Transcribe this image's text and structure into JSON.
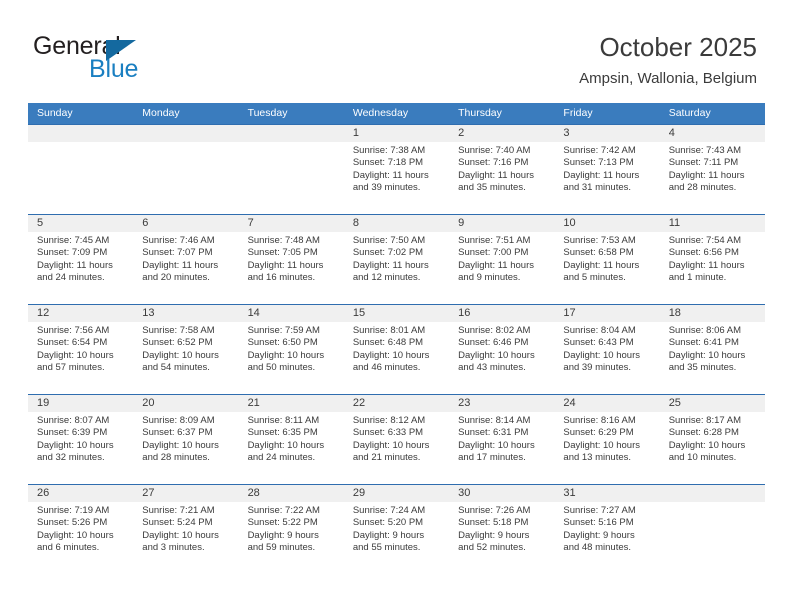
{
  "brand": {
    "word1": "General",
    "word2": "Blue",
    "logo_icon": "triangle-flag-icon",
    "color_primary": "#14699f",
    "color_text": "#231f20"
  },
  "header": {
    "title": "October 2025",
    "subtitle": "Ampsin, Wallonia, Belgium"
  },
  "theme": {
    "header_row_bg": "#3a7cbe",
    "week_divider": "#2f6daf",
    "daynum_band_bg": "#f0f0f0",
    "text": "#3b3b3b"
  },
  "weekday_headers": [
    "Sunday",
    "Monday",
    "Tuesday",
    "Wednesday",
    "Thursday",
    "Friday",
    "Saturday"
  ],
  "weeks": [
    [
      {
        "day": "",
        "empty": true,
        "sunrise": "",
        "sunset": "",
        "daylight_l1": "",
        "daylight_l2": ""
      },
      {
        "day": "",
        "empty": true,
        "sunrise": "",
        "sunset": "",
        "daylight_l1": "",
        "daylight_l2": ""
      },
      {
        "day": "",
        "empty": true,
        "sunrise": "",
        "sunset": "",
        "daylight_l1": "",
        "daylight_l2": ""
      },
      {
        "day": "1",
        "empty": false,
        "sunrise": "Sunrise: 7:38 AM",
        "sunset": "Sunset: 7:18 PM",
        "daylight_l1": "Daylight: 11 hours",
        "daylight_l2": "and 39 minutes."
      },
      {
        "day": "2",
        "empty": false,
        "sunrise": "Sunrise: 7:40 AM",
        "sunset": "Sunset: 7:16 PM",
        "daylight_l1": "Daylight: 11 hours",
        "daylight_l2": "and 35 minutes."
      },
      {
        "day": "3",
        "empty": false,
        "sunrise": "Sunrise: 7:42 AM",
        "sunset": "Sunset: 7:13 PM",
        "daylight_l1": "Daylight: 11 hours",
        "daylight_l2": "and 31 minutes."
      },
      {
        "day": "4",
        "empty": false,
        "sunrise": "Sunrise: 7:43 AM",
        "sunset": "Sunset: 7:11 PM",
        "daylight_l1": "Daylight: 11 hours",
        "daylight_l2": "and 28 minutes."
      }
    ],
    [
      {
        "day": "5",
        "empty": false,
        "sunrise": "Sunrise: 7:45 AM",
        "sunset": "Sunset: 7:09 PM",
        "daylight_l1": "Daylight: 11 hours",
        "daylight_l2": "and 24 minutes."
      },
      {
        "day": "6",
        "empty": false,
        "sunrise": "Sunrise: 7:46 AM",
        "sunset": "Sunset: 7:07 PM",
        "daylight_l1": "Daylight: 11 hours",
        "daylight_l2": "and 20 minutes."
      },
      {
        "day": "7",
        "empty": false,
        "sunrise": "Sunrise: 7:48 AM",
        "sunset": "Sunset: 7:05 PM",
        "daylight_l1": "Daylight: 11 hours",
        "daylight_l2": "and 16 minutes."
      },
      {
        "day": "8",
        "empty": false,
        "sunrise": "Sunrise: 7:50 AM",
        "sunset": "Sunset: 7:02 PM",
        "daylight_l1": "Daylight: 11 hours",
        "daylight_l2": "and 12 minutes."
      },
      {
        "day": "9",
        "empty": false,
        "sunrise": "Sunrise: 7:51 AM",
        "sunset": "Sunset: 7:00 PM",
        "daylight_l1": "Daylight: 11 hours",
        "daylight_l2": "and 9 minutes."
      },
      {
        "day": "10",
        "empty": false,
        "sunrise": "Sunrise: 7:53 AM",
        "sunset": "Sunset: 6:58 PM",
        "daylight_l1": "Daylight: 11 hours",
        "daylight_l2": "and 5 minutes."
      },
      {
        "day": "11",
        "empty": false,
        "sunrise": "Sunrise: 7:54 AM",
        "sunset": "Sunset: 6:56 PM",
        "daylight_l1": "Daylight: 11 hours",
        "daylight_l2": "and 1 minute."
      }
    ],
    [
      {
        "day": "12",
        "empty": false,
        "sunrise": "Sunrise: 7:56 AM",
        "sunset": "Sunset: 6:54 PM",
        "daylight_l1": "Daylight: 10 hours",
        "daylight_l2": "and 57 minutes."
      },
      {
        "day": "13",
        "empty": false,
        "sunrise": "Sunrise: 7:58 AM",
        "sunset": "Sunset: 6:52 PM",
        "daylight_l1": "Daylight: 10 hours",
        "daylight_l2": "and 54 minutes."
      },
      {
        "day": "14",
        "empty": false,
        "sunrise": "Sunrise: 7:59 AM",
        "sunset": "Sunset: 6:50 PM",
        "daylight_l1": "Daylight: 10 hours",
        "daylight_l2": "and 50 minutes."
      },
      {
        "day": "15",
        "empty": false,
        "sunrise": "Sunrise: 8:01 AM",
        "sunset": "Sunset: 6:48 PM",
        "daylight_l1": "Daylight: 10 hours",
        "daylight_l2": "and 46 minutes."
      },
      {
        "day": "16",
        "empty": false,
        "sunrise": "Sunrise: 8:02 AM",
        "sunset": "Sunset: 6:46 PM",
        "daylight_l1": "Daylight: 10 hours",
        "daylight_l2": "and 43 minutes."
      },
      {
        "day": "17",
        "empty": false,
        "sunrise": "Sunrise: 8:04 AM",
        "sunset": "Sunset: 6:43 PM",
        "daylight_l1": "Daylight: 10 hours",
        "daylight_l2": "and 39 minutes."
      },
      {
        "day": "18",
        "empty": false,
        "sunrise": "Sunrise: 8:06 AM",
        "sunset": "Sunset: 6:41 PM",
        "daylight_l1": "Daylight: 10 hours",
        "daylight_l2": "and 35 minutes."
      }
    ],
    [
      {
        "day": "19",
        "empty": false,
        "sunrise": "Sunrise: 8:07 AM",
        "sunset": "Sunset: 6:39 PM",
        "daylight_l1": "Daylight: 10 hours",
        "daylight_l2": "and 32 minutes."
      },
      {
        "day": "20",
        "empty": false,
        "sunrise": "Sunrise: 8:09 AM",
        "sunset": "Sunset: 6:37 PM",
        "daylight_l1": "Daylight: 10 hours",
        "daylight_l2": "and 28 minutes."
      },
      {
        "day": "21",
        "empty": false,
        "sunrise": "Sunrise: 8:11 AM",
        "sunset": "Sunset: 6:35 PM",
        "daylight_l1": "Daylight: 10 hours",
        "daylight_l2": "and 24 minutes."
      },
      {
        "day": "22",
        "empty": false,
        "sunrise": "Sunrise: 8:12 AM",
        "sunset": "Sunset: 6:33 PM",
        "daylight_l1": "Daylight: 10 hours",
        "daylight_l2": "and 21 minutes."
      },
      {
        "day": "23",
        "empty": false,
        "sunrise": "Sunrise: 8:14 AM",
        "sunset": "Sunset: 6:31 PM",
        "daylight_l1": "Daylight: 10 hours",
        "daylight_l2": "and 17 minutes."
      },
      {
        "day": "24",
        "empty": false,
        "sunrise": "Sunrise: 8:16 AM",
        "sunset": "Sunset: 6:29 PM",
        "daylight_l1": "Daylight: 10 hours",
        "daylight_l2": "and 13 minutes."
      },
      {
        "day": "25",
        "empty": false,
        "sunrise": "Sunrise: 8:17 AM",
        "sunset": "Sunset: 6:28 PM",
        "daylight_l1": "Daylight: 10 hours",
        "daylight_l2": "and 10 minutes."
      }
    ],
    [
      {
        "day": "26",
        "empty": false,
        "sunrise": "Sunrise: 7:19 AM",
        "sunset": "Sunset: 5:26 PM",
        "daylight_l1": "Daylight: 10 hours",
        "daylight_l2": "and 6 minutes."
      },
      {
        "day": "27",
        "empty": false,
        "sunrise": "Sunrise: 7:21 AM",
        "sunset": "Sunset: 5:24 PM",
        "daylight_l1": "Daylight: 10 hours",
        "daylight_l2": "and 3 minutes."
      },
      {
        "day": "28",
        "empty": false,
        "sunrise": "Sunrise: 7:22 AM",
        "sunset": "Sunset: 5:22 PM",
        "daylight_l1": "Daylight: 9 hours",
        "daylight_l2": "and 59 minutes."
      },
      {
        "day": "29",
        "empty": false,
        "sunrise": "Sunrise: 7:24 AM",
        "sunset": "Sunset: 5:20 PM",
        "daylight_l1": "Daylight: 9 hours",
        "daylight_l2": "and 55 minutes."
      },
      {
        "day": "30",
        "empty": false,
        "sunrise": "Sunrise: 7:26 AM",
        "sunset": "Sunset: 5:18 PM",
        "daylight_l1": "Daylight: 9 hours",
        "daylight_l2": "and 52 minutes."
      },
      {
        "day": "31",
        "empty": false,
        "sunrise": "Sunrise: 7:27 AM",
        "sunset": "Sunset: 5:16 PM",
        "daylight_l1": "Daylight: 9 hours",
        "daylight_l2": "and 48 minutes."
      },
      {
        "day": "",
        "empty": true,
        "sunrise": "",
        "sunset": "",
        "daylight_l1": "",
        "daylight_l2": ""
      }
    ]
  ]
}
